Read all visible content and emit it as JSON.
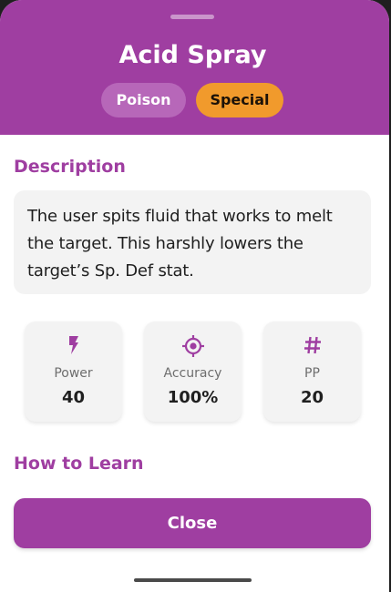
{
  "move": {
    "name": "Acid Spray",
    "type_chip": "Poison",
    "category_chip": "Special"
  },
  "description": {
    "heading": "Description",
    "text": "The user spits fluid that works to melt the target. This harshly lowers the target’s Sp. Def stat."
  },
  "stats": [
    {
      "icon": "bolt-icon",
      "label": "Power",
      "value": "40"
    },
    {
      "icon": "target-icon",
      "label": "Accuracy",
      "value": "100%"
    },
    {
      "icon": "hash-icon",
      "label": "PP",
      "value": "20"
    }
  ],
  "learn": {
    "heading": "How to Learn"
  },
  "close_label": "Close",
  "colors": {
    "accent": "#9f3ea1",
    "type_chip_bg": "#b767b9",
    "category_chip_bg": "#f19a2c",
    "card_bg": "#f3f3f3"
  }
}
